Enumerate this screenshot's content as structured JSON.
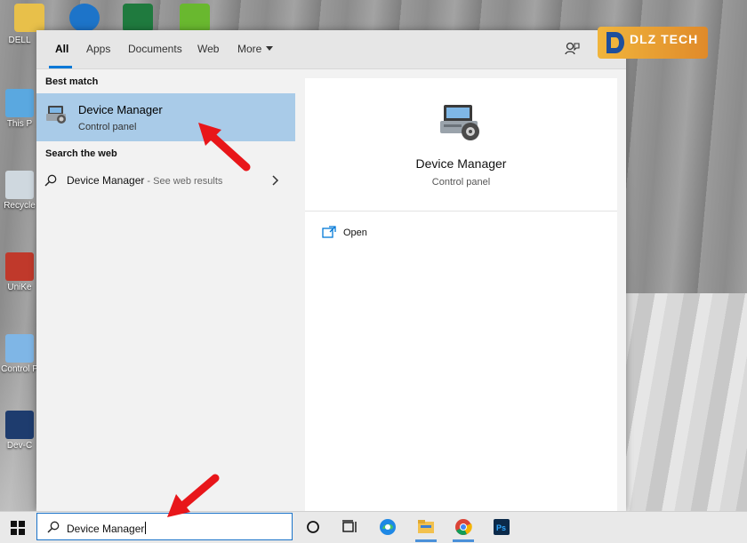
{
  "desktop": {
    "icons": [
      {
        "label": "DELL"
      },
      {
        "label": "This P"
      },
      {
        "label": "Recycle"
      },
      {
        "label": "UniKe"
      },
      {
        "label": "Control P"
      },
      {
        "label": "Dev-C"
      }
    ]
  },
  "tabs": [
    {
      "label": "All",
      "active": true
    },
    {
      "label": "Apps"
    },
    {
      "label": "Documents"
    },
    {
      "label": "Web"
    },
    {
      "label": "More"
    }
  ],
  "best_match": {
    "section": "Best match",
    "title": "Device Manager",
    "subtitle": "Control panel"
  },
  "web": {
    "section": "Search the web",
    "query": "Device Manager",
    "suffix": " - See web results"
  },
  "preview": {
    "title": "Device Manager",
    "subtitle": "Control panel",
    "action_open": "Open"
  },
  "logo": {
    "text": "DLZ TECH"
  },
  "taskbar": {
    "search_value": "Device Manager"
  },
  "colors": {
    "accent": "#0078d7",
    "selection": "#a9cbe8",
    "arrow": "#e8161a"
  }
}
